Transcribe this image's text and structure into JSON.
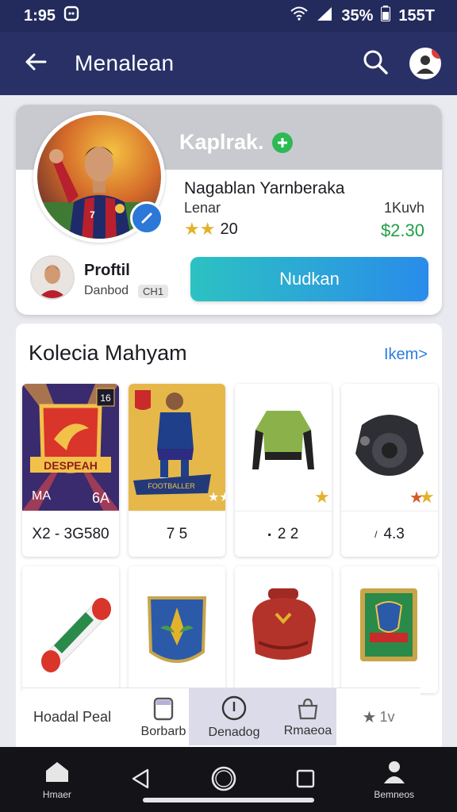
{
  "status": {
    "time": "1:95",
    "battery": "35%",
    "clock": "155T"
  },
  "appbar": {
    "title": "Menalean"
  },
  "profile": {
    "name": "Kaplrak.",
    "subtitle": "Nagablan Yarnberaka",
    "left_label": "Lenar",
    "right_label": "1Kuvh",
    "rating": "20",
    "money": "$2.30",
    "profile_label": "Proftil",
    "profile_sub": "Danbod",
    "profile_tag": "CH1",
    "action_label": "Nudkan"
  },
  "collection": {
    "title": "Kolecia Mahyam",
    "see_more": "Ikem>",
    "items": [
      {
        "value": "X2 - 3G580"
      },
      {
        "value": "7 5"
      },
      {
        "value": "2 2"
      },
      {
        "value": "4.3"
      }
    ]
  },
  "collection_nav": {
    "left_label": "Hoadal Peal",
    "tab1": "Borbarb",
    "tab2": "Denadog",
    "tab3": "Rmaeoa",
    "tab4": "1v"
  },
  "navbar": {
    "home": "Hmaer",
    "profile": "Bemneos"
  },
  "colors": {
    "appbar": "#283066",
    "accent": "#2a8cea",
    "money": "#1ea046",
    "plus": "#2db954"
  }
}
